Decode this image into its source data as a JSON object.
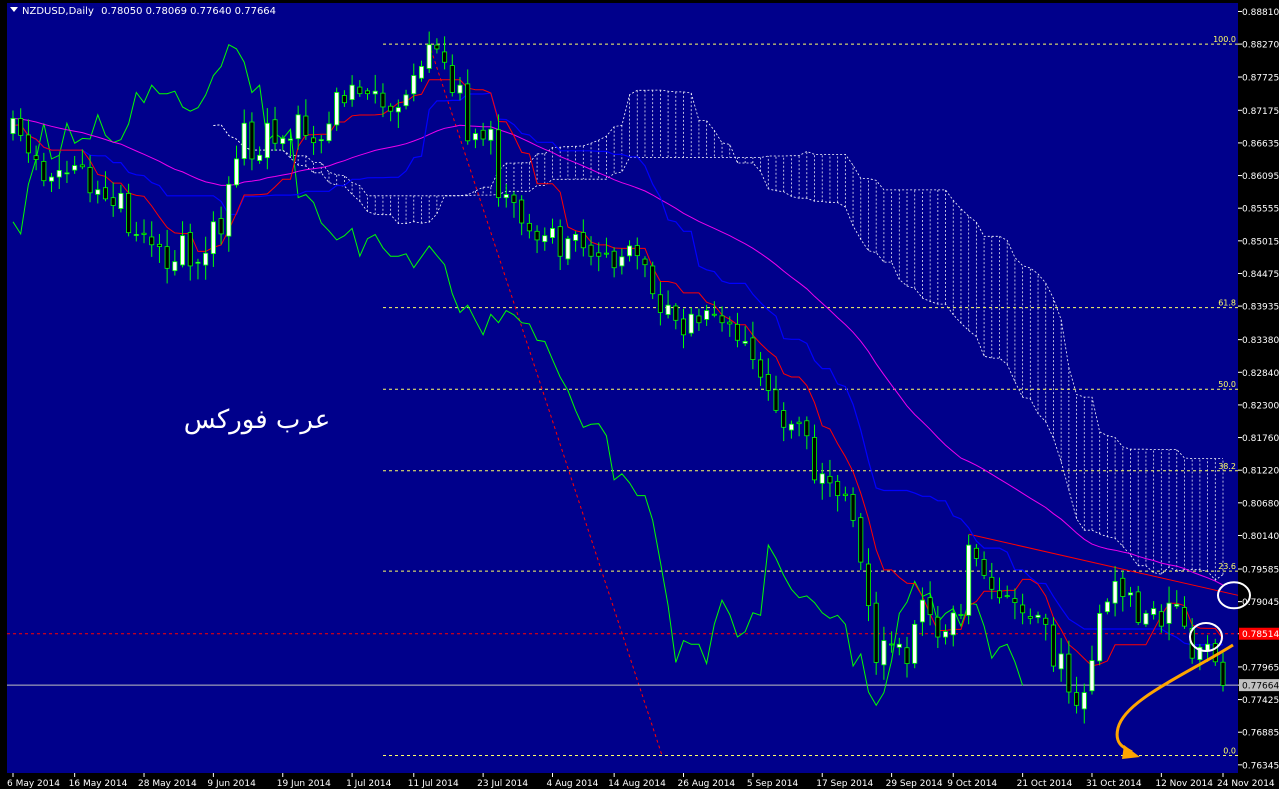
{
  "header": {
    "symbol": "NZDUSD,Daily",
    "ohlc": "0.78050 0.78069 0.77640 0.77664"
  },
  "watermark": "عرب فوركس",
  "colors": {
    "background": "#00008B",
    "frame": "#000000",
    "axis_text": "#FFFFFF",
    "candle_bull": "#FFFFFF",
    "candle_bear": "#000000",
    "candle_outline": "#00FF00",
    "chikou": "#00FF00",
    "tenkan": "#FF0000",
    "kijun": "#0000FF",
    "ma": "#EE00EE",
    "cloud": "#FFFFFF",
    "fib": "#FFFF66",
    "price_line": "#C0C0C0",
    "ref_line": "#FF0000",
    "highlight": "#FFFFFF",
    "arrow": "#FFA500"
  },
  "chart_data": {
    "type": "candlestick",
    "title": "NZDUSD,Daily",
    "ylim": [
      0.7621,
      0.8895
    ],
    "y_ticks": [
      "0.88810",
      "0.88270",
      "0.87725",
      "0.87175",
      "0.86635",
      "0.86095",
      "0.85555",
      "0.85015",
      "0.84475",
      "0.83935",
      "0.83380",
      "0.82840",
      "0.82300",
      "0.81760",
      "0.81220",
      "0.80680",
      "0.80140",
      "0.79585",
      "0.79045",
      "0.78514",
      "0.77965",
      "0.77664",
      "0.77425",
      "0.76885",
      "0.76345"
    ],
    "x_ticks": [
      "6 May 2014",
      "16 May 2014",
      "28 May 2014",
      "9 Jun 2014",
      "19 Jun 2014",
      "1 Jul 2014",
      "11 Jul 2014",
      "23 Jul 2014",
      "4 Aug 2014",
      "14 Aug 2014",
      "26 Aug 2014",
      "5 Sep 2014",
      "17 Sep 2014",
      "29 Sep 2014",
      "9 Oct 2014",
      "21 Oct 2014",
      "31 Oct 2014",
      "12 Nov 2014",
      "24 Nov 2014"
    ],
    "tick_index": [
      0,
      8,
      17,
      26,
      35,
      44,
      52,
      61,
      70,
      78,
      87,
      96,
      105,
      114,
      122,
      131,
      140,
      149,
      157
    ],
    "current_price": "0.77664",
    "reference_price": "0.78514",
    "fibonacci": [
      {
        "label": "100.0",
        "price": 0.8827
      },
      {
        "label": "61.8",
        "price": 0.8391
      },
      {
        "label": "50.0",
        "price": 0.8256
      },
      {
        "label": "38.2",
        "price": 0.8121
      },
      {
        "label": "23.6",
        "price": 0.7955
      },
      {
        "label": "0.0",
        "price": 0.765
      }
    ],
    "closes": [
      0.8704,
      0.8676,
      0.8647,
      0.8636,
      0.8601,
      0.8607,
      0.8618,
      0.8614,
      0.8626,
      0.8624,
      0.8581,
      0.8586,
      0.8571,
      0.856,
      0.858,
      0.8515,
      0.8512,
      0.8512,
      0.8495,
      0.8492,
      0.8456,
      0.8467,
      0.851,
      0.846,
      0.8466,
      0.8481,
      0.8533,
      0.8513,
      0.8595,
      0.8637,
      0.8696,
      0.8637,
      0.8643,
      0.8696,
      0.8663,
      0.8671,
      0.867,
      0.871,
      0.8676,
      0.8664,
      0.8669,
      0.8695,
      0.8747,
      0.873,
      0.8759,
      0.8745,
      0.8745,
      0.8749,
      0.8723,
      0.8716,
      0.8722,
      0.8743,
      0.8775,
      0.879,
      0.8826,
      0.8819,
      0.8797,
      0.8747,
      0.8759,
      0.8667,
      0.8679,
      0.867,
      0.8686,
      0.8573,
      0.8578,
      0.8565,
      0.8531,
      0.8518,
      0.8503,
      0.851,
      0.8522,
      0.8476,
      0.8505,
      0.8512,
      0.849,
      0.8476,
      0.8476,
      0.848,
      0.8457,
      0.8475,
      0.8493,
      0.8477,
      0.8462,
      0.8414,
      0.8383,
      0.8395,
      0.837,
      0.8346,
      0.838,
      0.8366,
      0.8386,
      0.8379,
      0.8366,
      0.8364,
      0.8337,
      0.8335,
      0.8305,
      0.8276,
      0.8254,
      0.8221,
      0.8193,
      0.8198,
      0.8199,
      0.8179,
      0.8106,
      0.8116,
      0.8101,
      0.808,
      0.808,
      0.8039,
      0.797,
      0.7898,
      0.7804,
      0.784,
      0.7834,
      0.7834,
      0.7802,
      0.7867,
      0.7907,
      0.7883,
      0.7846,
      0.7855,
      0.7886,
      0.7882,
      0.7998,
      0.7976,
      0.7948,
      0.7925,
      0.7911,
      0.7914,
      0.7903,
      0.7886,
      0.7877,
      0.7882,
      0.7867,
      0.7798,
      0.7818,
      0.7755,
      0.7733,
      0.7754,
      0.7807,
      0.7885,
      0.7904,
      0.7938,
      0.7913,
      0.7919,
      0.787,
      0.7885,
      0.7893,
      0.7864,
      0.7902,
      0.79,
      0.7864,
      0.7811,
      0.7829,
      0.7834,
      0.7805,
      0.7766
    ]
  }
}
